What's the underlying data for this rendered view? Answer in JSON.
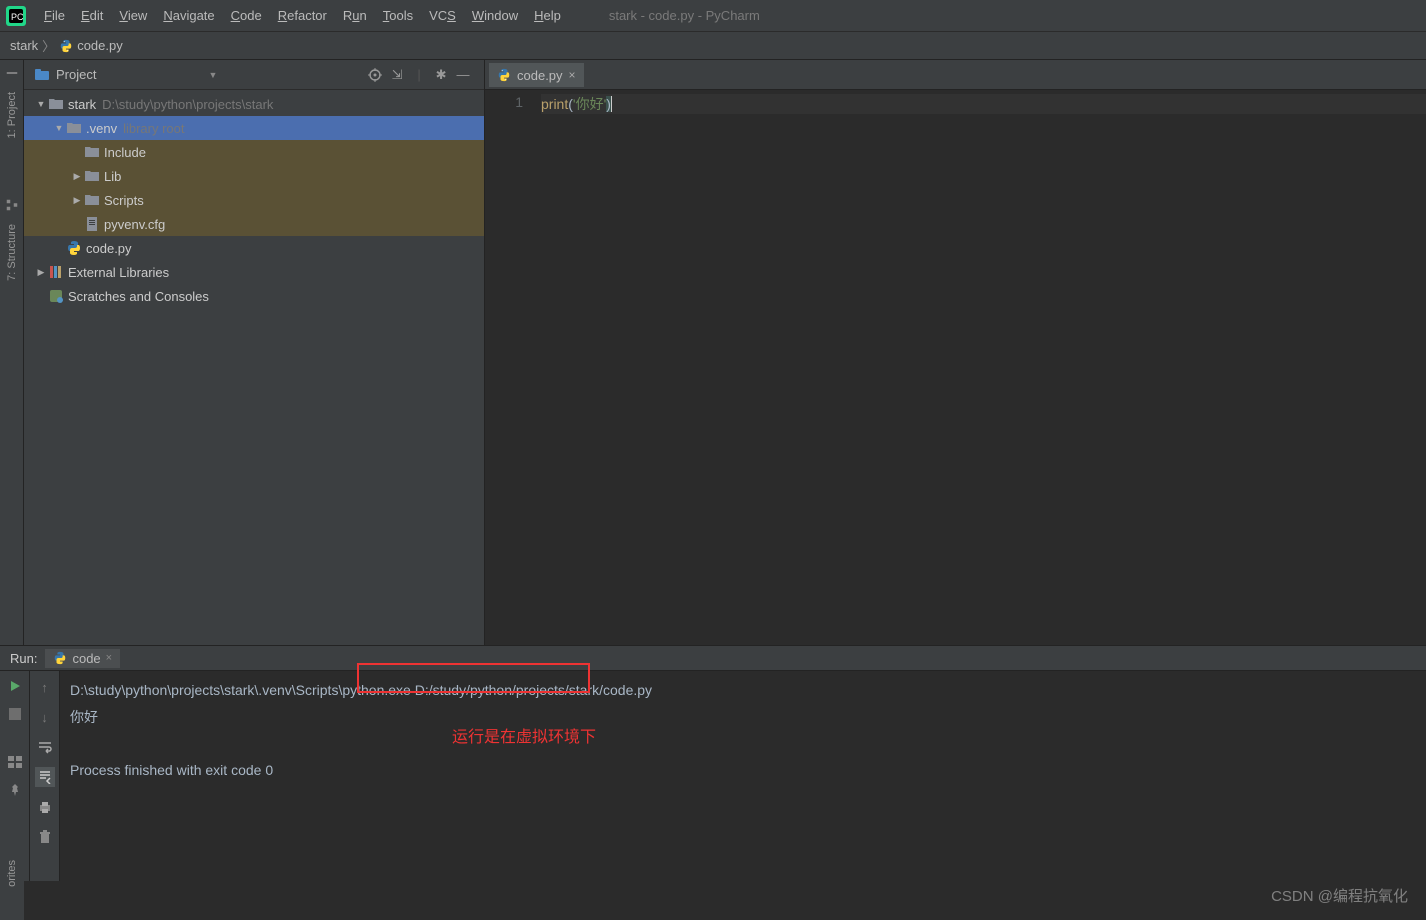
{
  "menubar": {
    "items": [
      "File",
      "Edit",
      "View",
      "Navigate",
      "Code",
      "Refactor",
      "Run",
      "Tools",
      "VCS",
      "Window",
      "Help"
    ],
    "window_title": "stark - code.py - PyCharm"
  },
  "breadcrumb": {
    "project": "stark",
    "file": "code.py"
  },
  "left_rail": {
    "project": "1: Project",
    "structure": "7: Structure"
  },
  "project_panel": {
    "title": "Project",
    "tree": [
      {
        "depth": 0,
        "arrow": "▼",
        "kind": "folder",
        "label": "stark",
        "hint": "D:\\study\\python\\projects\\stark"
      },
      {
        "depth": 1,
        "arrow": "▼",
        "kind": "folder",
        "label": ".venv",
        "hint": "library root",
        "row": "selected"
      },
      {
        "depth": 2,
        "arrow": "",
        "kind": "folder",
        "label": "Include",
        "row": "highlight"
      },
      {
        "depth": 2,
        "arrow": "▶",
        "kind": "folder",
        "label": "Lib",
        "row": "highlight"
      },
      {
        "depth": 2,
        "arrow": "▶",
        "kind": "folder",
        "label": "Scripts",
        "row": "highlight"
      },
      {
        "depth": 2,
        "arrow": "",
        "kind": "file-txt",
        "label": "pyvenv.cfg",
        "row": "highlight"
      },
      {
        "depth": 1,
        "arrow": "",
        "kind": "file-py",
        "label": "code.py"
      },
      {
        "depth": 0,
        "arrow": "▶",
        "kind": "lib",
        "label": "External Libraries"
      },
      {
        "depth": 0,
        "arrow": "",
        "kind": "scratch",
        "label": "Scratches and Consoles"
      }
    ]
  },
  "editor": {
    "tab": "code.py",
    "lineno": "1",
    "code": {
      "fn": "print",
      "open": "(",
      "str": "'你好'",
      "close": ")"
    }
  },
  "run": {
    "title": "Run:",
    "tab": "code",
    "output": [
      "D:\\study\\python\\projects\\stark\\.venv\\Scripts\\python.exe D:/study/python/projects/stark/code.py",
      "你好",
      "",
      "Process finished with exit code 0"
    ],
    "annotation": "运行是在虚拟环境下"
  },
  "watermark": "CSDN @编程抗氧化",
  "fav": "orites"
}
